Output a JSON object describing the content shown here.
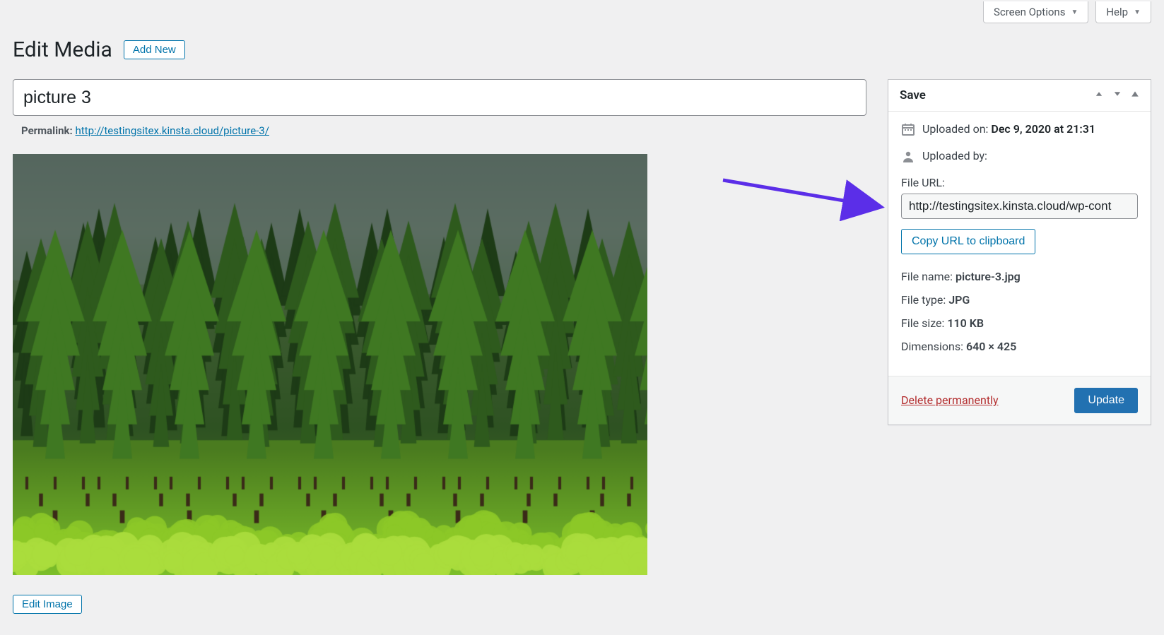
{
  "top_tabs": {
    "screen_options": "Screen Options",
    "help": "Help"
  },
  "heading": {
    "title": "Edit Media",
    "add_new": "Add New"
  },
  "post": {
    "title_value": "picture 3",
    "permalink_label": "Permalink:",
    "permalink_url": "http://testingsitex.kinsta.cloud/picture-3/"
  },
  "edit_image_label": "Edit Image",
  "save_box": {
    "title": "Save",
    "uploaded_on_label": "Uploaded on:",
    "uploaded_on_value": "Dec 9, 2020 at 21:31",
    "uploaded_by_label": "Uploaded by:",
    "uploaded_by_value": "",
    "file_url_label": "File URL:",
    "file_url_value": "http://testingsitex.kinsta.cloud/wp-cont",
    "copy_url_label": "Copy URL to clipboard",
    "file_name_label": "File name:",
    "file_name_value": "picture-3.jpg",
    "file_type_label": "File type:",
    "file_type_value": "JPG",
    "file_size_label": "File size:",
    "file_size_value": "110 KB",
    "dimensions_label": "Dimensions:",
    "dimensions_value": "640 × 425",
    "delete_label": "Delete permanently",
    "update_label": "Update"
  }
}
